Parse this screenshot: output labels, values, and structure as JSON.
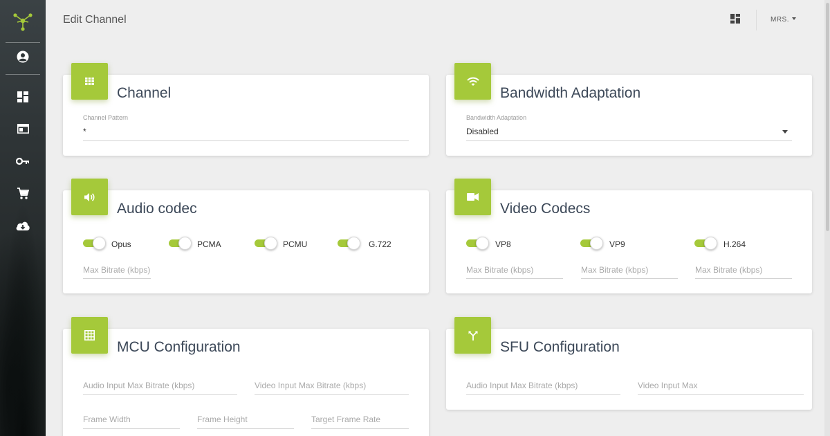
{
  "header": {
    "title": "Edit Channel",
    "user_menu": "MRS."
  },
  "sidebar": {
    "items": [
      {
        "icon": "account-icon"
      },
      {
        "icon": "dashboard-icon"
      },
      {
        "icon": "window-icon"
      },
      {
        "icon": "key-icon"
      },
      {
        "icon": "cart-icon"
      },
      {
        "icon": "download-cloud-icon"
      }
    ]
  },
  "accent_color": "#a5c93a",
  "cards": {
    "channel": {
      "title": "Channel",
      "pattern_label": "Channel Pattern",
      "pattern_value": "*"
    },
    "bandwidth": {
      "title": "Bandwidth Adaptation",
      "label": "Bandwidth Adaptation",
      "value": "Disabled"
    },
    "audio": {
      "title": "Audio codec",
      "codecs": [
        "Opus",
        "PCMA",
        "PCMU",
        "G.722"
      ],
      "max_bitrate_placeholder": "Max Bitrate (kbps)"
    },
    "video": {
      "title": "Video Codecs",
      "codecs": [
        "VP8",
        "VP9",
        "H.264"
      ],
      "max_bitrate_placeholder": "Max Bitrate (kbps)"
    },
    "mcu": {
      "title": "MCU Configuration",
      "audio_input_placeholder": "Audio Input Max Bitrate (kbps)",
      "video_input_placeholder": "Video Input Max Bitrate (kbps)",
      "frame_width_placeholder": "Frame Width",
      "frame_height_placeholder": "Frame Height",
      "target_frame_rate_placeholder": "Target Frame Rate"
    },
    "sfu": {
      "title": "SFU Configuration",
      "audio_input_placeholder": "Audio Input Max Bitrate (kbps)",
      "video_input_placeholder": "Video Input Max"
    }
  }
}
